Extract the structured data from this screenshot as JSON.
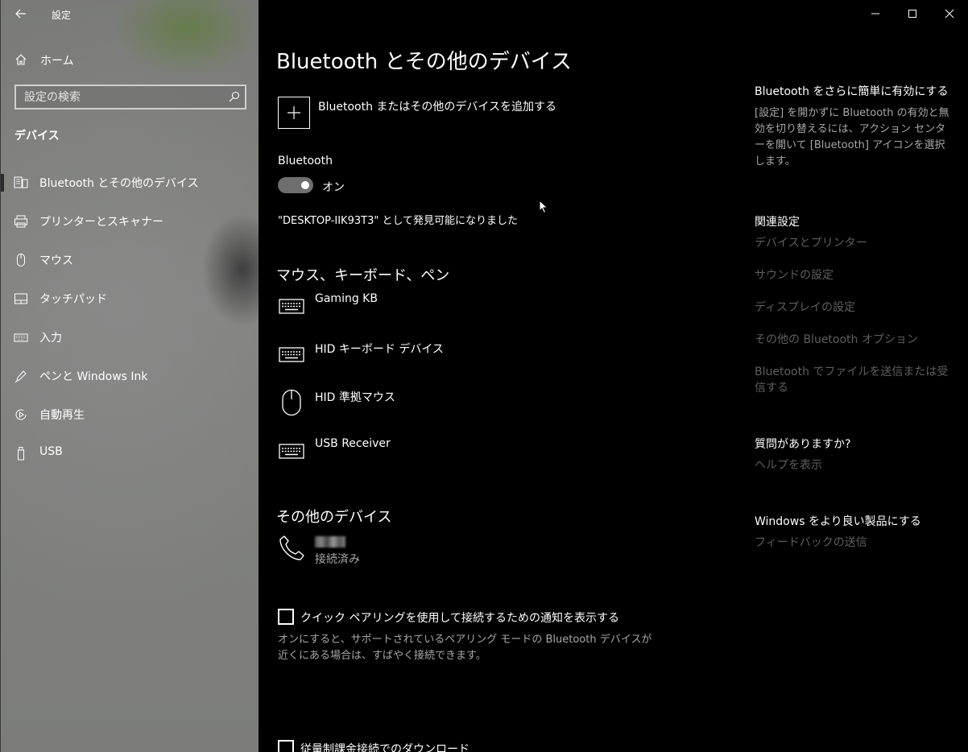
{
  "window": {
    "app_title": "設定"
  },
  "sidebar": {
    "home_label": "ホーム",
    "search_placeholder": "設定の検索",
    "section_title": "デバイス",
    "items": [
      {
        "label": "Bluetooth とその他のデバイス",
        "icon": "bluetooth-devices-icon",
        "selected": true
      },
      {
        "label": "プリンターとスキャナー",
        "icon": "printer-icon",
        "selected": false
      },
      {
        "label": "マウス",
        "icon": "mouse-icon",
        "selected": false
      },
      {
        "label": "タッチパッド",
        "icon": "touchpad-icon",
        "selected": false
      },
      {
        "label": "入力",
        "icon": "keyboard-icon",
        "selected": false
      },
      {
        "label": "ペンと Windows Ink",
        "icon": "pen-icon",
        "selected": false
      },
      {
        "label": "自動再生",
        "icon": "autoplay-icon",
        "selected": false
      },
      {
        "label": "USB",
        "icon": "usb-icon",
        "selected": false
      }
    ]
  },
  "main": {
    "title": "Bluetooth とその他のデバイス",
    "add_device_label": "Bluetooth またはその他のデバイスを追加する",
    "bluetooth_label": "Bluetooth",
    "bluetooth_state": "オン",
    "discoverable_text": "\"DESKTOP-IIK93T3\" として発見可能になりました",
    "mouse_keyboard_section": "マウス、キーボード、ペン",
    "input_devices": [
      {
        "name": "Gaming KB",
        "icon": "keyboard-icon"
      },
      {
        "name": "HID キーボード デバイス",
        "icon": "keyboard-icon"
      },
      {
        "name": "HID 準拠マウス",
        "icon": "mouse-icon"
      },
      {
        "name": "USB Receiver",
        "icon": "keyboard-icon"
      }
    ],
    "other_section": "その他のデバイス",
    "other_devices": [
      {
        "status": "接続済み",
        "icon": "phone-icon"
      }
    ],
    "swift_pair_label": "クイック ペアリングを使用して接続するための通知を表示する",
    "swift_pair_desc": "オンにすると、サポートされているペアリング モードの Bluetooth デバイスが近くにある場合は、すばやく接続できます。",
    "metered_label": "従量制課金接続でのダウンロード"
  },
  "right": {
    "tip_title": "Bluetooth をさらに簡単に有効にする",
    "tip_text": "[設定] を開かずに Bluetooth の有効と無効を切り替えるには、アクション センターを開いて [Bluetooth] アイコンを選択します。",
    "related_title": "関連設定",
    "related_links": [
      "デバイスとプリンター",
      "サウンドの設定",
      "ディスプレイの設定",
      "その他の Bluetooth オプション",
      "Bluetooth でファイルを送信または受信する"
    ],
    "question_title": "質問がありますか?",
    "help_link": "ヘルプを表示",
    "improve_title": "Windows をより良い製品にする",
    "feedback_link": "フィードバックの送信"
  }
}
